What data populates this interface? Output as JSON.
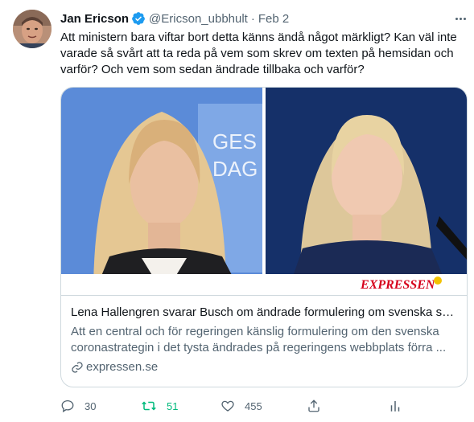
{
  "tweet": {
    "author_name": "Jan Ericson",
    "author_handle": "@Ericson_ubbhult",
    "separator": "·",
    "date": "Feb 2",
    "text": "Att ministern bara viftar bort detta känns ändå något märkligt? Kan väl inte varade så svårt att ta reda på vem som skrev om texten på hemsidan och varför? Och vem som sedan ändrade tillbaka och varför?"
  },
  "card": {
    "image_logo": "EXPRESSEN",
    "image_backdrop_text": [
      "GES",
      "DAG"
    ],
    "title": "Lena Hallengren svarar Busch om ändrade formulering om svenska str...",
    "description_line1": "Att en central och för regeringen känslig formulering om den svenska",
    "description_line2": "coronastrategin i det tysta ändrades på regeringens webbplats förra ...",
    "domain": "expressen.se"
  },
  "actions": {
    "replies": "30",
    "retweets": "51",
    "likes": "455"
  },
  "icons": {
    "verified": "verified-badge-icon",
    "more": "more-icon",
    "reply": "reply-icon",
    "retweet": "retweet-icon",
    "like": "like-icon",
    "share": "share-icon",
    "analytics": "analytics-icon",
    "link": "link-icon"
  },
  "colors": {
    "text": "#0f1419",
    "secondary": "#536471",
    "verified": "#1d9bf0",
    "retweet_active": "#00ba7c",
    "border": "#cfd9de",
    "expressen_red": "#d6001c"
  }
}
